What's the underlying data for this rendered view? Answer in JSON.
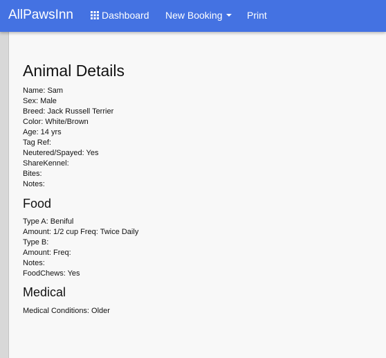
{
  "navbar": {
    "brand": "AllPawsInn",
    "items": [
      {
        "label": "Dashboard",
        "icon": "grid-icon"
      },
      {
        "label": "New Booking",
        "icon": "caret-down-icon"
      },
      {
        "label": "Print"
      }
    ],
    "background": "#4472e2"
  },
  "page": {
    "title": "Animal Details",
    "fields": [
      "Name: Sam",
      "Sex: Male",
      "Breed: Jack Russell Terrier",
      "Color: White/Brown",
      "Age: 14 yrs",
      "Tag Ref:",
      "Neutered/Spayed: Yes",
      "ShareKennel:",
      "Bites:",
      "Notes:"
    ]
  },
  "food": {
    "title": "Food",
    "fields": [
      "Type A: Beniful",
      "Amount: 1/2 cup Freq: Twice Daily",
      "Type B:",
      "Amount: Freq:",
      "Notes:",
      "FoodChews: Yes"
    ]
  },
  "medical": {
    "title": "Medical",
    "fields": [
      "Medical Conditions: Older"
    ]
  }
}
